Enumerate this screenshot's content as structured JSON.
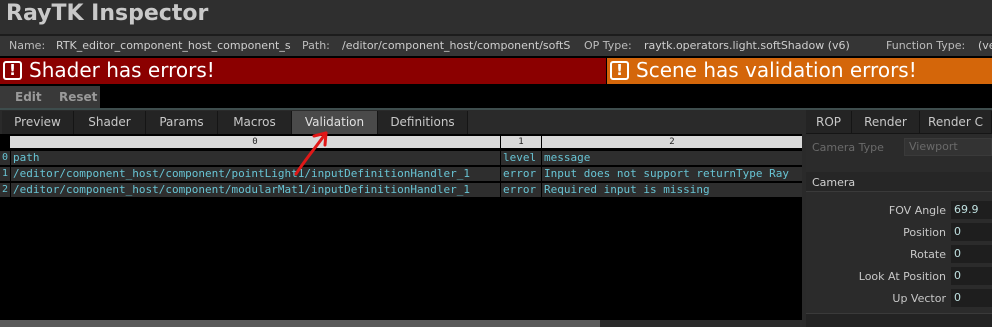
{
  "app": {
    "title": "RayTK Inspector"
  },
  "info": {
    "name_label": "Name:",
    "name_value": "RTK_editor_component_host_component_s",
    "path_label": "Path:",
    "path_value": "/editor/component_host/component/softS",
    "optype_label": "OP Type:",
    "optype_value": "raytk.operators.light.softShadow (v6)",
    "functype_label": "Function Type:",
    "functype_value": "(ve"
  },
  "banners": {
    "shader_error": "Shader has errors!",
    "scene_error": "Scene has validation errors!"
  },
  "toolbar": {
    "edit_label": "Edit",
    "reset_label": "Reset"
  },
  "tabs": [
    "Preview",
    "Shader",
    "Params",
    "Macros",
    "Validation",
    "Definitions"
  ],
  "active_tab": "Validation",
  "table": {
    "col_indices": [
      "0",
      "1",
      "2"
    ],
    "row_indices": [
      "0",
      "1",
      "2"
    ],
    "rows": [
      [
        "path",
        "level",
        "message"
      ],
      [
        "/editor/component_host/component/pointLight1/inputDefinitionHandler_1",
        "error",
        "Input does not support returnType Ray"
      ],
      [
        "/editor/component_host/component/modularMat1/inputDefinitionHandler_1",
        "error",
        "Required input is missing"
      ]
    ]
  },
  "right_tabs": [
    "ROP",
    "Render",
    "Render C"
  ],
  "camera": {
    "type_label": "Camera Type",
    "type_value": "Viewport",
    "section_label": "Camera",
    "params": [
      {
        "label": "FOV Angle",
        "value": "69.9"
      },
      {
        "label": "Position",
        "value": "0"
      },
      {
        "label": "Rotate",
        "value": "0"
      },
      {
        "label": "Look At Position",
        "value": "0"
      },
      {
        "label": "Up Vector",
        "value": "0"
      }
    ]
  },
  "colors": {
    "error_banner": "#8b0000",
    "warning_banner": "#d4660a",
    "cell_text": "#68c4d4",
    "annotation_arrow": "#e01818"
  },
  "icons": {
    "banner_icon": "exclamation-box-icon",
    "annotation": "red-arrow-icon"
  }
}
